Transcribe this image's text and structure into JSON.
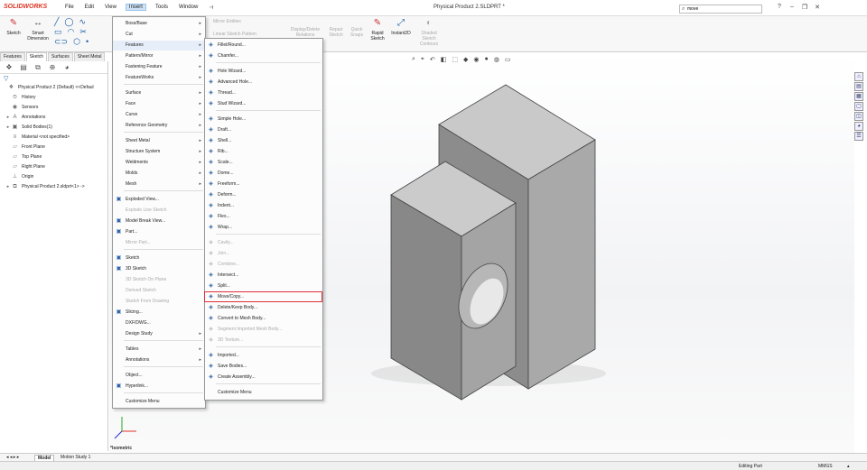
{
  "app": {
    "logo": "SOLIDWORKS",
    "document_title": "Physical Product 2.SLDPRT *",
    "menus": [
      "File",
      "Edit",
      "View",
      "Insert",
      "Tools",
      "Window"
    ],
    "search_value": "move"
  },
  "ribbon": {
    "sketch": "Sketch",
    "smart_dimension": "Smart Dimension",
    "mirror_entities": "Mirror Entities",
    "linear_sketch_pattern": "Linear Sketch Pattern",
    "display_delete_relations": "Display/Delete Relations",
    "repair_sketch": "Repair Sketch",
    "quick_snaps": "Quick Snaps",
    "rapid_sketch": "Rapid Sketch",
    "instant2d": "Instant2D",
    "shaded_sketch_contours": "Shaded Sketch Contours"
  },
  "command_tabs": [
    "Features",
    "Sketch",
    "Surfaces",
    "Sheet Metal"
  ],
  "tree": {
    "items": [
      {
        "label": "Physical Product 2 (Default) <<Defaul",
        "icon": "part-icon",
        "arrow": ""
      },
      {
        "label": "History",
        "icon": "history-icon",
        "arrow": ""
      },
      {
        "label": "Sensors",
        "icon": "sensor-icon",
        "arrow": ""
      },
      {
        "label": "Annotations",
        "icon": "annotation-icon",
        "arrow": "▸"
      },
      {
        "label": "Solid Bodies(1)",
        "icon": "solid-bodies-icon",
        "arrow": "▸"
      },
      {
        "label": "Material <not specified>",
        "icon": "material-icon",
        "arrow": ""
      },
      {
        "label": "Front Plane",
        "icon": "plane-icon",
        "arrow": ""
      },
      {
        "label": "Top Plane",
        "icon": "plane-icon",
        "arrow": ""
      },
      {
        "label": "Right Plane",
        "icon": "plane-icon",
        "arrow": ""
      },
      {
        "label": "Origin",
        "icon": "origin-icon",
        "arrow": ""
      },
      {
        "label": "Physical Product 2.sldprt<1> ->",
        "icon": "derived-part-icon",
        "arrow": "▸"
      }
    ]
  },
  "insert_menu": {
    "items": [
      {
        "label": "Boss/Base",
        "sub": true,
        "disabled": false
      },
      {
        "label": "Cut",
        "sub": true,
        "disabled": false
      },
      {
        "label": "Features",
        "sub": true,
        "disabled": false,
        "highlighted": true
      },
      {
        "label": "Pattern/Mirror",
        "sub": true,
        "disabled": false
      },
      {
        "label": "Fastening Feature",
        "sub": true,
        "disabled": false
      },
      {
        "label": "FeatureWorks",
        "sub": true,
        "disabled": false
      },
      {
        "label": "Surface",
        "sub": true,
        "disabled": false
      },
      {
        "label": "Face",
        "sub": true,
        "disabled": false
      },
      {
        "label": "Curve",
        "sub": true,
        "disabled": false
      },
      {
        "label": "Reference Geometry",
        "sub": true,
        "disabled": false
      },
      {
        "label": "Sheet Metal",
        "sub": true,
        "disabled": false
      },
      {
        "label": "Structure System",
        "sub": true,
        "disabled": false
      },
      {
        "label": "Weldments",
        "sub": true,
        "disabled": false
      },
      {
        "label": "Molds",
        "sub": true,
        "disabled": false
      },
      {
        "label": "Mesh",
        "sub": true,
        "disabled": false
      },
      {
        "label": "Exploded View...",
        "sub": false,
        "disabled": false
      },
      {
        "label": "Explode Line Sketch",
        "sub": false,
        "disabled": true
      },
      {
        "label": "Model Break View...",
        "sub": false,
        "disabled": false
      },
      {
        "label": "Part...",
        "sub": false,
        "disabled": false
      },
      {
        "label": "Mirror Part...",
        "sub": false,
        "disabled": true
      },
      {
        "label": "Sketch",
        "sub": false,
        "disabled": false
      },
      {
        "label": "3D Sketch",
        "sub": false,
        "disabled": false
      },
      {
        "label": "3D Sketch On Plane",
        "sub": false,
        "disabled": true
      },
      {
        "label": "Derived Sketch",
        "sub": false,
        "disabled": true
      },
      {
        "label": "Sketch From Drawing",
        "sub": false,
        "disabled": true
      },
      {
        "label": "Slicing...",
        "sub": false,
        "disabled": false
      },
      {
        "label": "DXF/DWG...",
        "sub": false,
        "disabled": false
      },
      {
        "label": "Design Study",
        "sub": true,
        "disabled": false
      },
      {
        "label": "Tables",
        "sub": true,
        "disabled": false
      },
      {
        "label": "Annotations",
        "sub": true,
        "disabled": false
      },
      {
        "label": "Object...",
        "sub": false,
        "disabled": false
      },
      {
        "label": "Hyperlink...",
        "sub": false,
        "disabled": false
      },
      {
        "label": "Customize Menu",
        "sub": false,
        "disabled": false
      }
    ]
  },
  "features_menu": {
    "items": [
      {
        "label": "Fillet/Round...",
        "disabled": false
      },
      {
        "label": "Chamfer...",
        "disabled": false
      },
      {
        "label": "Hole Wizard...",
        "disabled": false
      },
      {
        "label": "Advanced Hole...",
        "disabled": false
      },
      {
        "label": "Thread...",
        "disabled": false
      },
      {
        "label": "Stud Wizard...",
        "disabled": false
      },
      {
        "label": "Simple Hole...",
        "disabled": false
      },
      {
        "label": "Draft...",
        "disabled": false
      },
      {
        "label": "Shell...",
        "disabled": false
      },
      {
        "label": "Rib...",
        "disabled": false
      },
      {
        "label": "Scale...",
        "disabled": false
      },
      {
        "label": "Dome...",
        "disabled": false
      },
      {
        "label": "Freeform...",
        "disabled": false
      },
      {
        "label": "Deform...",
        "disabled": false
      },
      {
        "label": "Indent...",
        "disabled": false
      },
      {
        "label": "Flex...",
        "disabled": false
      },
      {
        "label": "Wrap...",
        "disabled": false
      },
      {
        "label": "Cavity...",
        "disabled": true
      },
      {
        "label": "Join...",
        "disabled": true
      },
      {
        "label": "Combine...",
        "disabled": true
      },
      {
        "label": "Intersect...",
        "disabled": false
      },
      {
        "label": "Split...",
        "disabled": false
      },
      {
        "label": "Move/Copy...",
        "disabled": false
      },
      {
        "label": "Delete/Keep Body...",
        "disabled": false
      },
      {
        "label": "Convert to Mesh Body...",
        "disabled": false
      },
      {
        "label": "Segment Imported Mesh Body...",
        "disabled": true
      },
      {
        "label": "3D Texture...",
        "disabled": true
      },
      {
        "label": "Imported...",
        "disabled": false
      },
      {
        "label": "Save Bodies...",
        "disabled": false
      },
      {
        "label": "Create Assembly...",
        "disabled": false
      },
      {
        "label": "Customize Menu",
        "disabled": false
      }
    ]
  },
  "viewport": {
    "orientation_label": "*Isometric"
  },
  "bottom_tabs": [
    "Model",
    "Motion Study 1"
  ],
  "status": {
    "mode": "Editing Part",
    "units": "MMGS"
  },
  "colors": {
    "accent": "#d32f2f",
    "highlight_box": "#e0303a",
    "face_top": "#c9c9c9",
    "face_front": "#8c8c8c",
    "face_side": "#a9a9a9"
  }
}
